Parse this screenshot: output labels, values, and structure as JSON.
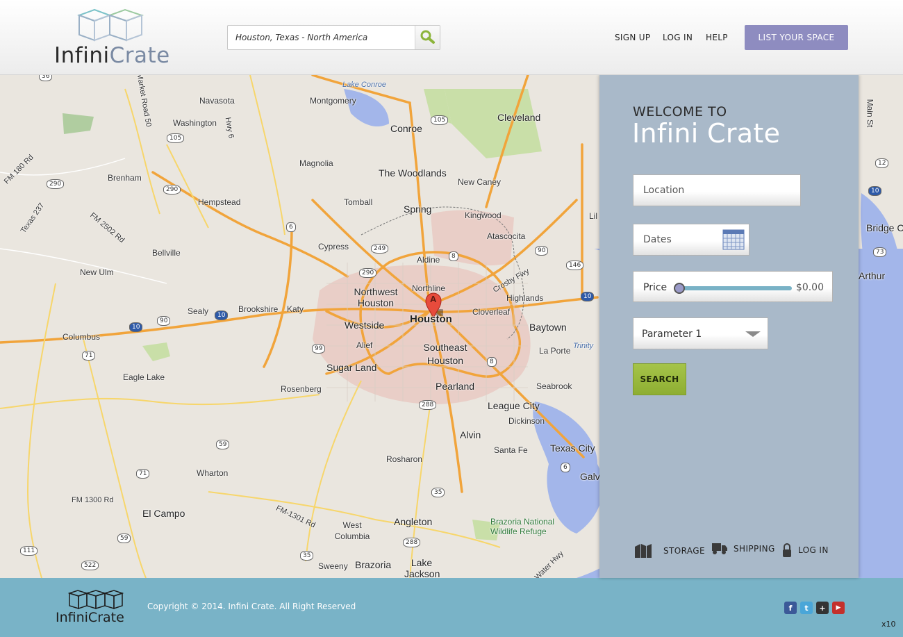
{
  "header": {
    "logo": {
      "part1": "Infini",
      "part2": "Crate"
    },
    "search": {
      "value": "Houston, Texas - North America"
    },
    "nav": {
      "signup": "SIGN UP",
      "login": "LOG IN",
      "help": "HELP"
    },
    "list_space": "LIST YOUR SPACE"
  },
  "map": {
    "marker": "A",
    "places": [
      "Navasota",
      "Montgomery",
      "Lake Conroe",
      "Conroe",
      "Cleveland",
      "Washington",
      "Brenham",
      "Magnolia",
      "The Woodlands",
      "New Caney",
      "Hempstead",
      "Tomball",
      "Spring",
      "Kingwood",
      "Atascocita",
      "Cypress",
      "Aldine",
      "Bellville",
      "New Ulm",
      "Northwest Houston",
      "Northline",
      "Crosby Fwy",
      "Highlands",
      "Sealy",
      "Brookshire",
      "Katy",
      "Westside",
      "Houston",
      "Cloverleaf",
      "Baytown",
      "Columbus",
      "Alief",
      "Southeast Houston",
      "Sugar Land",
      "La Porte",
      "Trinity",
      "Eagle Lake",
      "Rosenberg",
      "Pearland",
      "Seabrook",
      "League City",
      "Dickinson",
      "Alvin",
      "Santa Fe",
      "Texas City",
      "Galv",
      "Rosharon",
      "Wharton",
      "El Campo",
      "Angleton",
      "West Columbia",
      "Brazoria National Wildlife Refuge",
      "Brazoria",
      "Sweeny",
      "Lake Jackson",
      "Bridge City",
      "Arthur",
      "Main St",
      "FM 180 Rd",
      "FM 2502 Rd",
      "FM 1300 Rd",
      "FM-1301 Rd",
      "Market Road 50",
      "Hwy 6",
      "Texas 237",
      "Water Hwy",
      "Lil"
    ],
    "shields": [
      "36",
      "105",
      "105",
      "290",
      "290",
      "6",
      "249",
      "290",
      "8",
      "90",
      "146",
      "10",
      "90",
      "99",
      "10",
      "10",
      "71",
      "8",
      "288",
      "59",
      "71",
      "35",
      "59",
      "288",
      "35",
      "111",
      "522",
      "6",
      "12",
      "10",
      "73"
    ]
  },
  "panel": {
    "welcome": "WELCOME TO",
    "title": "Infini Crate",
    "location_placeholder": "Location",
    "dates_placeholder": "Dates",
    "price_label": "Price",
    "price_value": "$0.00",
    "price_slider_fraction": 0.0,
    "parameter": "Parameter 1",
    "search": "SEARCH",
    "links": {
      "storage": "STORAGE",
      "shipping": "SHIPPING",
      "login": "LOG IN"
    }
  },
  "footer": {
    "logo": "InfiniCrate",
    "copyright": "Copyright © 2014. Infini Crate. All Right Reserved",
    "social": [
      "facebook-icon",
      "twitter-icon",
      "google-plus-icon",
      "youtube-icon"
    ],
    "social_glyphs": {
      "facebook": "f",
      "twitter": "t",
      "google": "+",
      "youtube": "▶"
    },
    "colors": {
      "facebook": "#3b5998",
      "twitter": "#4aa6d8",
      "google": "#333333",
      "youtube": "#c4302b"
    },
    "x10": "x10"
  },
  "colors": {
    "list_button": "#8e8cc0",
    "panel": "#a9b9c9",
    "search_button": "#9bb83e",
    "footer": "#79b3c7"
  }
}
